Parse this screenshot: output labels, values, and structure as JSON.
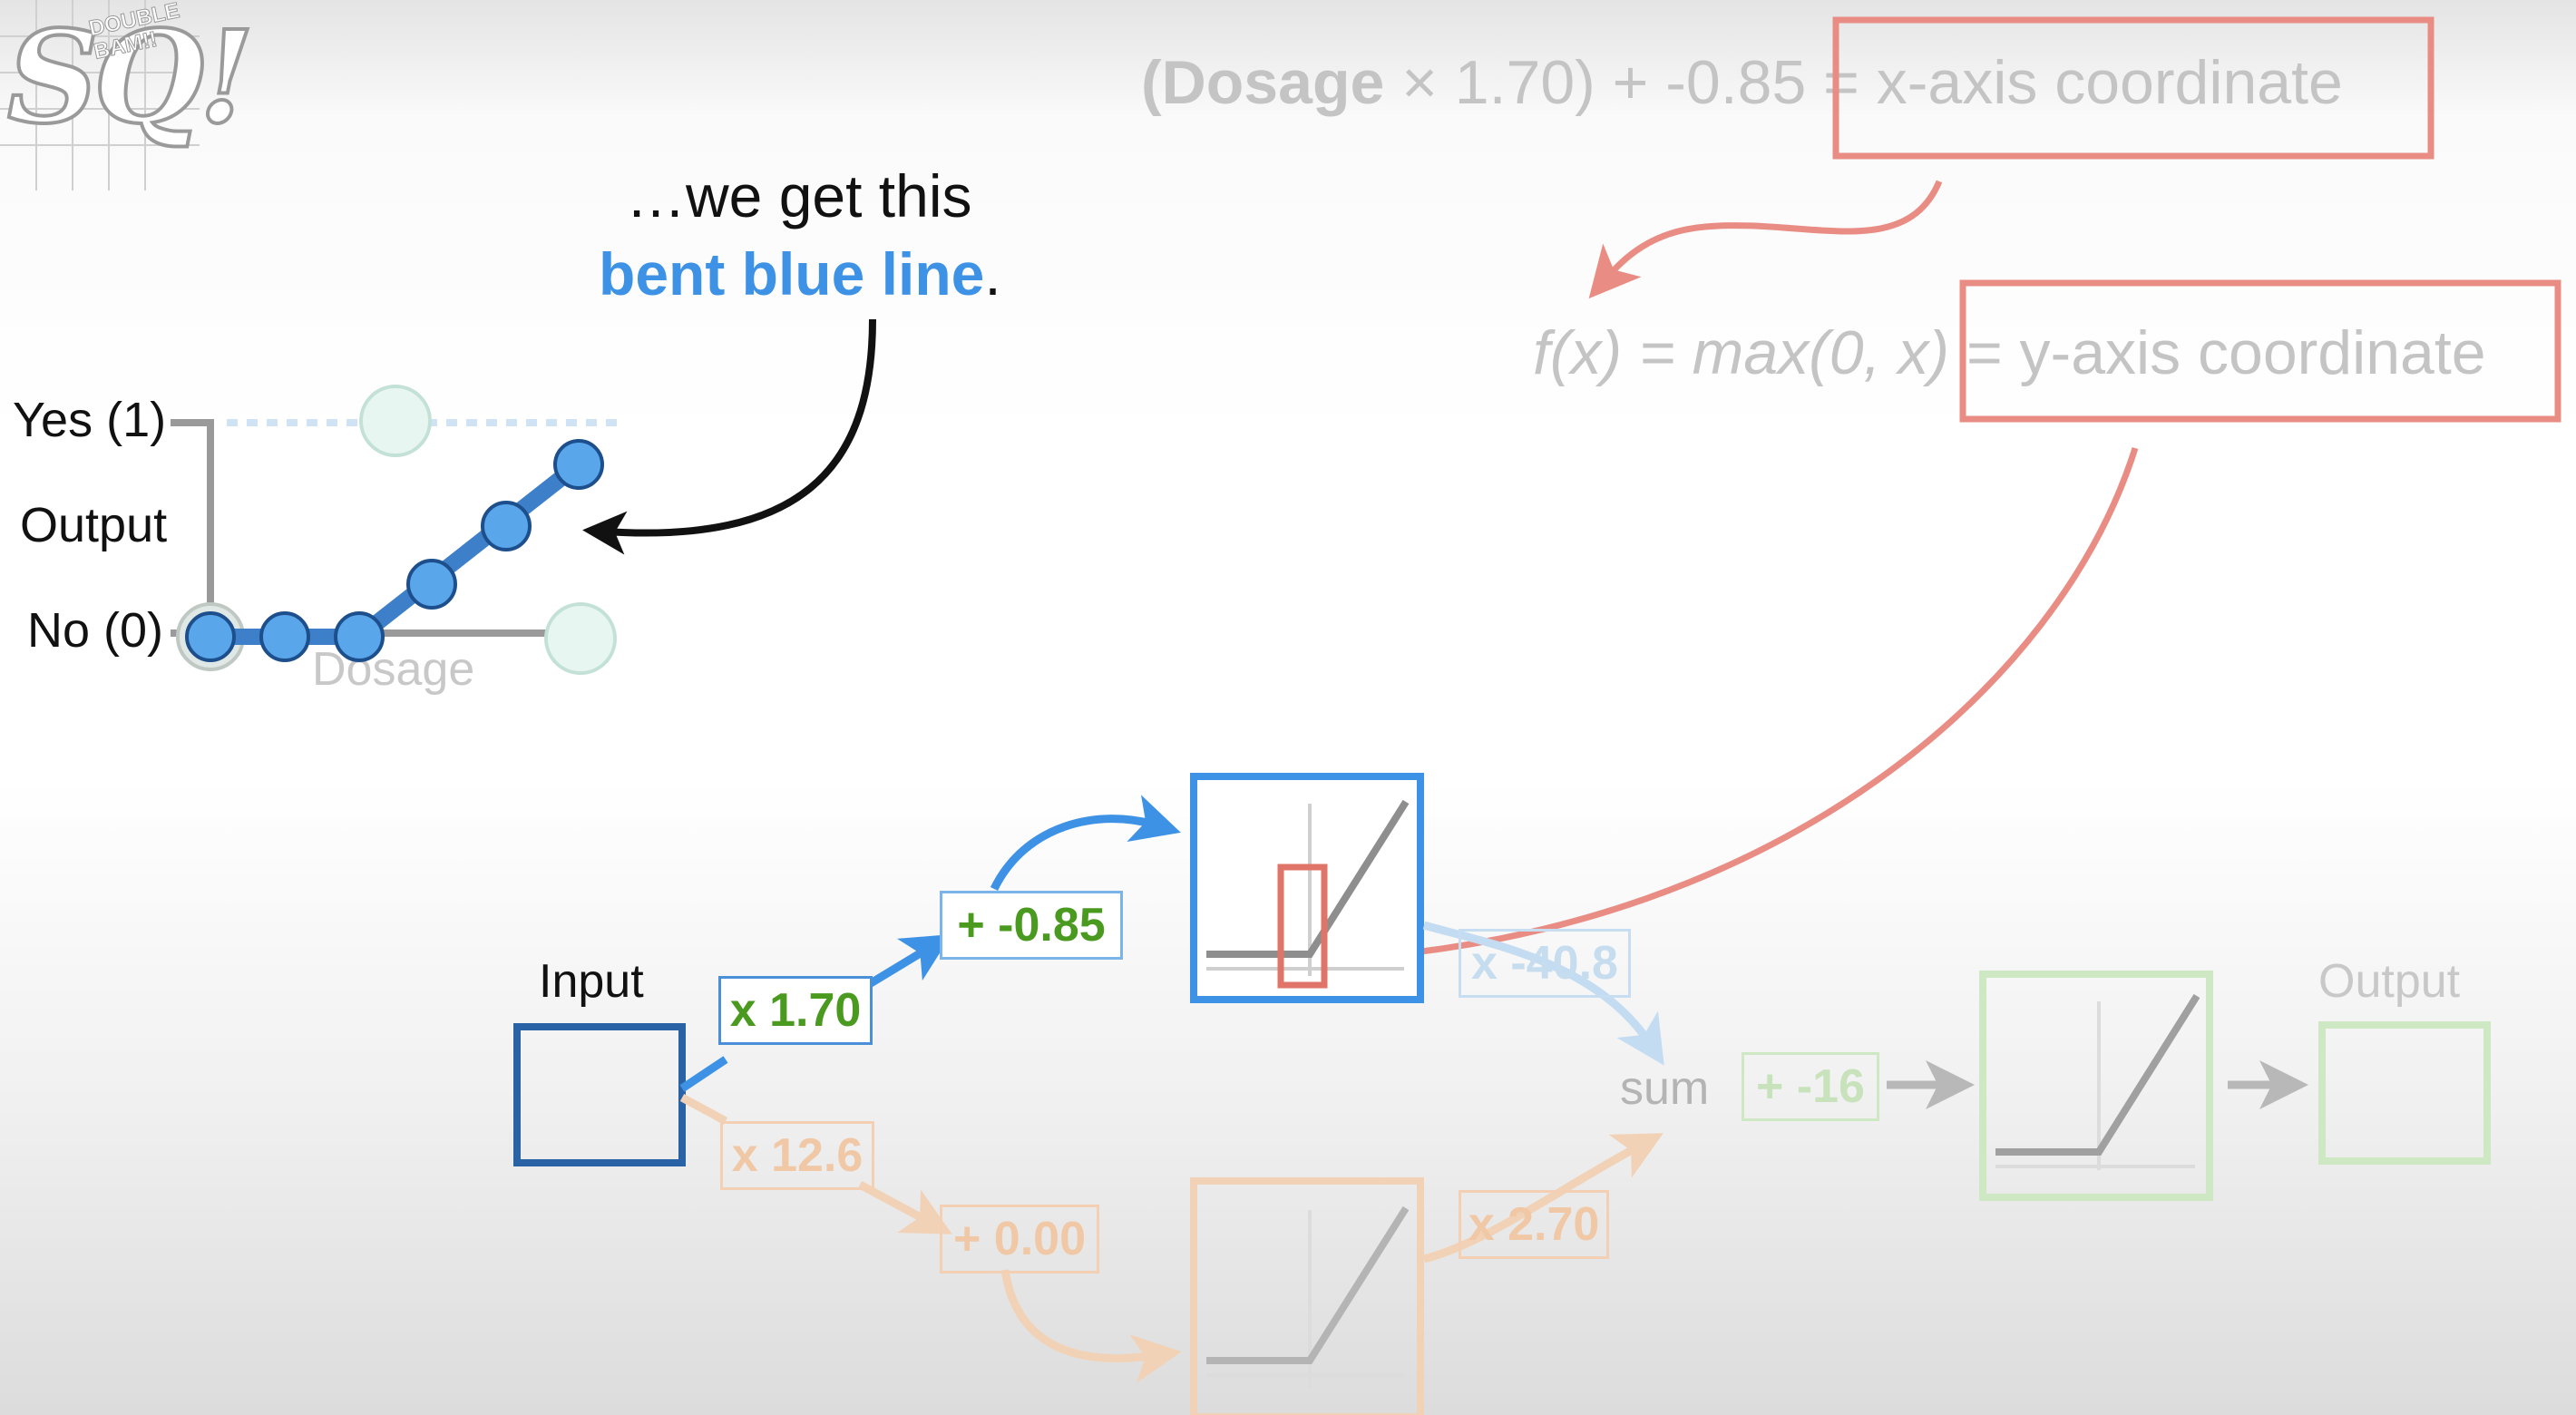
{
  "logo": {
    "letters": "SQ!",
    "small_text": "DOUBLE BAM!!"
  },
  "callout": {
    "line1": "…we get this",
    "line2_highlight": "bent blue line",
    "line2_end": "."
  },
  "mini_graph": {
    "y_label_top": "Yes (1)",
    "y_label_mid": "Output",
    "y_label_bottom": "No (0)",
    "x_label": "Dosage",
    "line_color": "#3e7fc9",
    "point_color": "#5aa6ea"
  },
  "equation1": {
    "open_paren": "(",
    "dosage": "Dosage",
    "times": " × 1.70) + -0.85 ",
    "boxed": "= x-axis coordinate"
  },
  "equation2": {
    "fx": "f(x) = max(0, x)",
    "boxed": "= y-axis coordinate"
  },
  "network": {
    "input_label": "Input",
    "output_label": "Output",
    "sum_label": "sum",
    "w_top": "x 1.70",
    "b_top": "+ -0.85",
    "w_top_out": "x -40.8",
    "w_bottom": "x 12.6",
    "b_bottom": "+ 0.00",
    "w_bottom_out": "x 2.70",
    "b_final": "+ -16"
  },
  "colors": {
    "blue": "#3e92e6",
    "dark_blue": "#2a62a6",
    "red": "#e07469",
    "green": "#4a9a20",
    "gray_text": "#c4c4c4"
  }
}
